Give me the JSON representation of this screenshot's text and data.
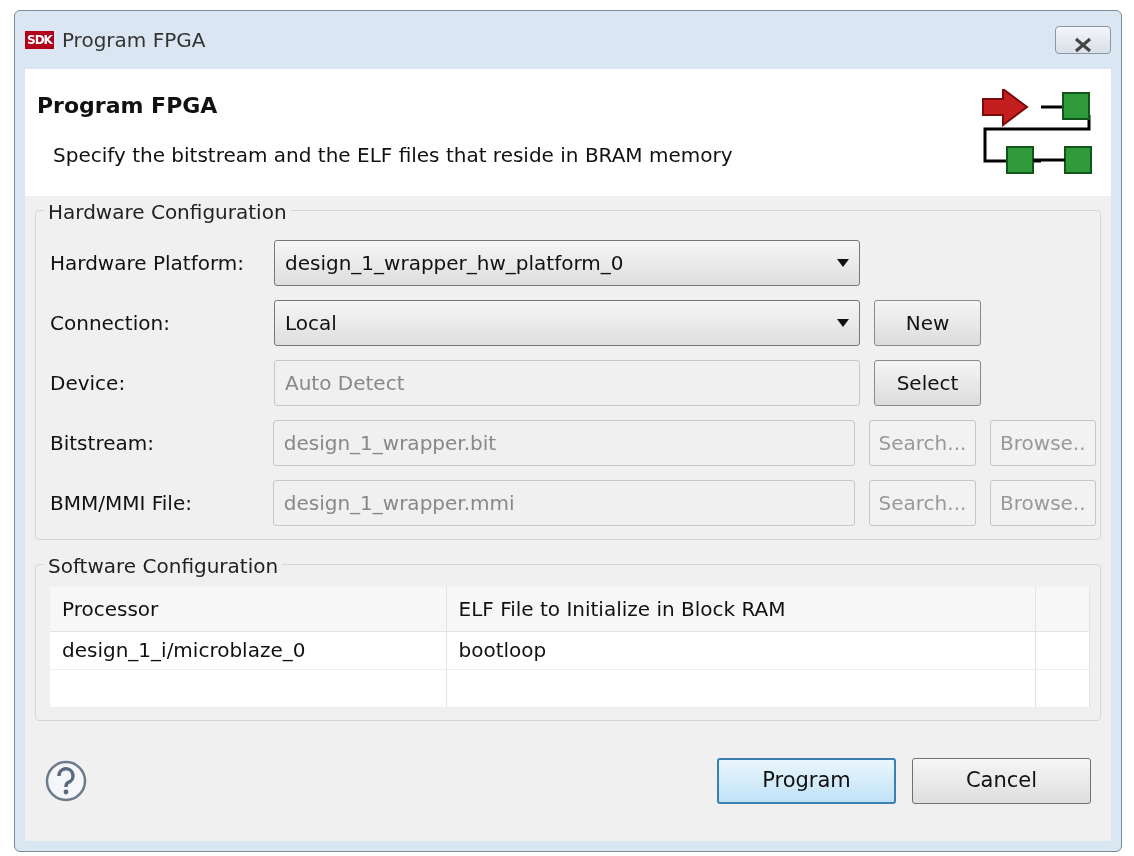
{
  "window": {
    "logo_text": "SDK",
    "title": "Program FPGA"
  },
  "header": {
    "title": "Program FPGA",
    "description": "Specify the bitstream and the ELF files that reside in BRAM memory"
  },
  "hardware": {
    "legend": "Hardware Configuration",
    "rows": [
      {
        "label": "Hardware Platform:",
        "kind": "combo",
        "value": "design_1_wrapper_hw_platform_0",
        "disabled": false,
        "buttons": []
      },
      {
        "label": "Connection:",
        "kind": "combo",
        "value": "Local",
        "disabled": false,
        "buttons": [
          {
            "label": "New",
            "disabled": false
          }
        ]
      },
      {
        "label": "Device:",
        "kind": "text",
        "value": "Auto Detect",
        "disabled": true,
        "buttons": [
          {
            "label": "Select",
            "disabled": false
          }
        ]
      },
      {
        "label": "Bitstream:",
        "kind": "text",
        "value": "design_1_wrapper.bit",
        "disabled": true,
        "buttons": [
          {
            "label": "Search...",
            "disabled": true
          },
          {
            "label": "Browse..",
            "disabled": true
          }
        ]
      },
      {
        "label": "BMM/MMI File:",
        "kind": "text",
        "value": "design_1_wrapper.mmi",
        "disabled": true,
        "buttons": [
          {
            "label": "Search...",
            "disabled": true
          },
          {
            "label": "Browse..",
            "disabled": true
          }
        ]
      }
    ]
  },
  "software": {
    "legend": "Software Configuration",
    "table": {
      "columns": [
        "Processor",
        "ELF File to Initialize in Block RAM"
      ],
      "rows": [
        [
          "design_1_i/microblaze_0",
          "bootloop"
        ]
      ]
    }
  },
  "buttons": [
    {
      "label": "Program",
      "default": true
    },
    {
      "label": "Cancel",
      "default": false
    }
  ]
}
